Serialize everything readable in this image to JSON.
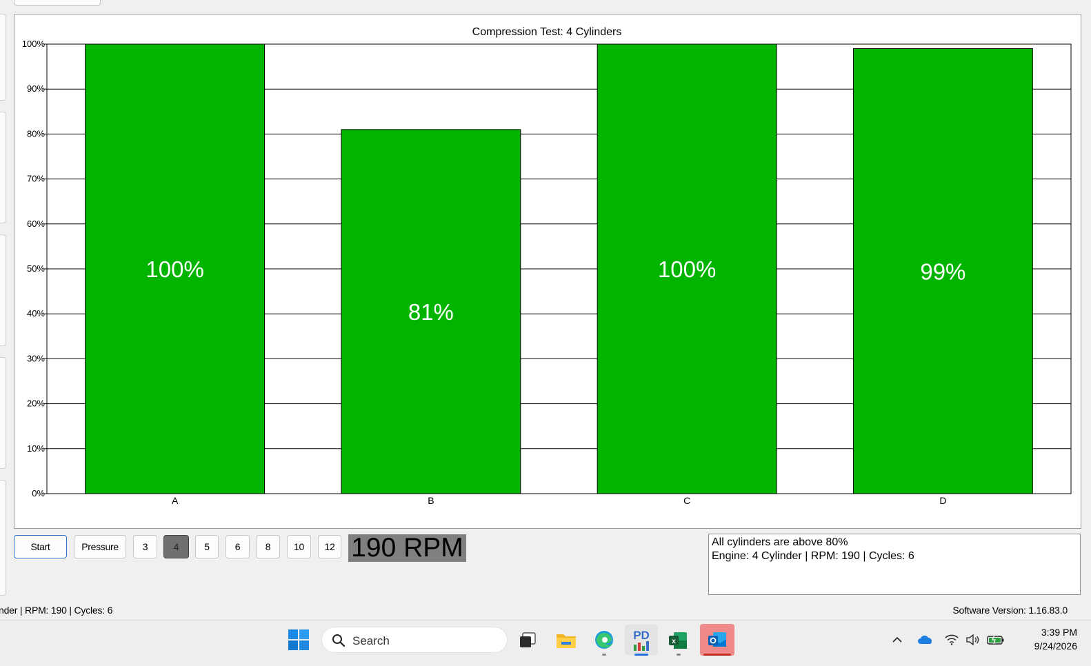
{
  "chart_data": {
    "type": "bar",
    "title": "Compression Test: 4 Cylinders",
    "categories": [
      "A",
      "B",
      "C",
      "D"
    ],
    "values": [
      100,
      81,
      100,
      99
    ],
    "value_labels": [
      "100%",
      "81%",
      "100%",
      "99%"
    ],
    "y_ticks": [
      "0%",
      "10%",
      "20%",
      "30%",
      "40%",
      "50%",
      "60%",
      "70%",
      "80%",
      "90%",
      "100%"
    ],
    "ylim": [
      0,
      100
    ],
    "grid": true,
    "bar_color": "#00b400"
  },
  "controls": {
    "start_label": "Start",
    "pressure_label": "Pressure",
    "cylinder_options": [
      "3",
      "4",
      "5",
      "6",
      "8",
      "10",
      "12"
    ],
    "selected_cylinders": "4",
    "rpm_display": "190 RPM"
  },
  "message": {
    "line1": "All cylinders are above 80%",
    "line2": "Engine: 4 Cylinder | RPM: 190 | Cycles: 6"
  },
  "status_bar": {
    "left": "nder | RPM: 190 | Cycles: 6",
    "right": "Software Version: 1.16.83.0"
  },
  "taskbar": {
    "search_label": "Search",
    "time": "3:39 PM",
    "date": "9/24/2026",
    "pd_app_label": "PD",
    "icons": [
      "windows-start",
      "search",
      "task-view",
      "file-explorer",
      "edge",
      "pd-app",
      "excel",
      "outlook",
      "show-hidden-icons",
      "onedrive",
      "wifi",
      "volume",
      "battery"
    ]
  }
}
